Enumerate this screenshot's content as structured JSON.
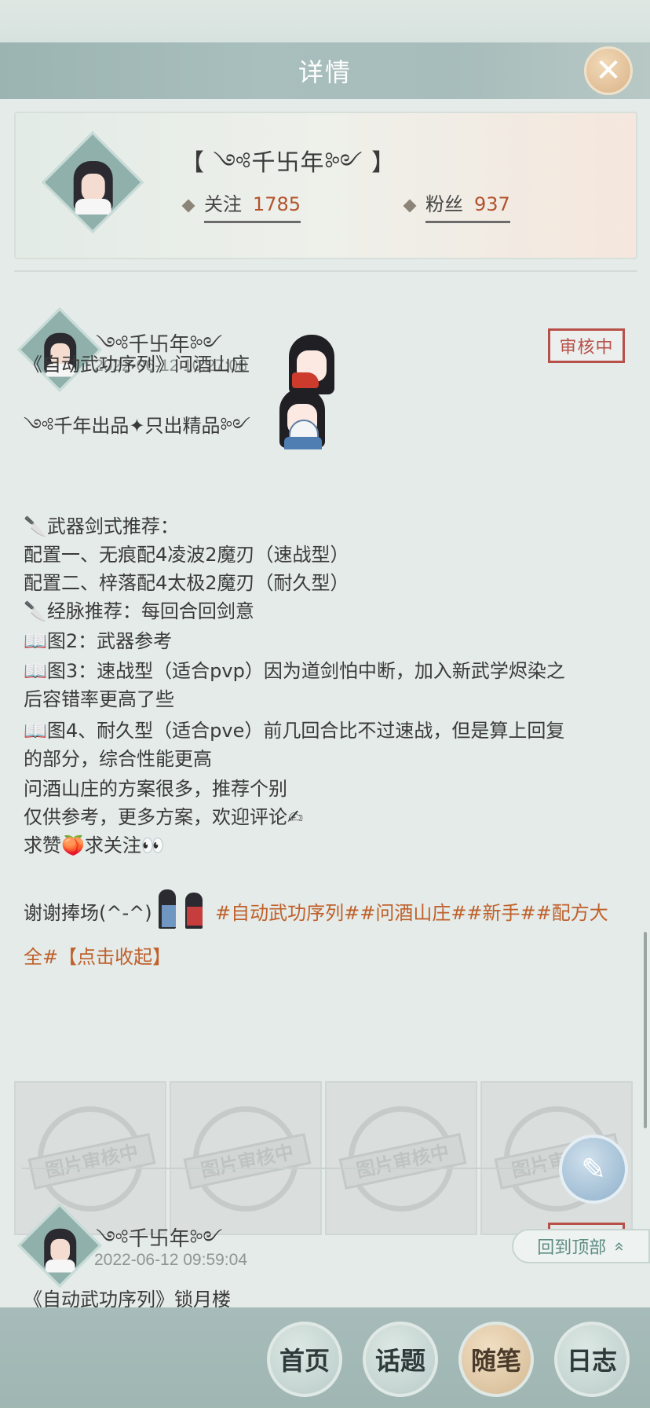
{
  "header": {
    "title": "详情",
    "close_label": "✕"
  },
  "profile": {
    "name": "【 ༺千卐年༻ 】",
    "follow_label": "关注",
    "follow_count": "1785",
    "fans_label": "粉丝",
    "fans_count": "937"
  },
  "posts": [
    {
      "author": "༺千卐年༻",
      "timestamp": "2022-06-12 10:27:08",
      "status": "审核中",
      "lines": [
        "《自动武功序列》问酒山庄",
        "༺千年出品✦只出精品༻",
        "🔪武器剑式推荐：",
        "配置一、无痕配4凌波2魔刃（速战型）",
        "配置二、梓落配4太极2魔刃（耐久型）",
        "🔪经脉推荐：每回合回剑意",
        "📖图2：武器参考",
        "📖图3：速战型（适合pvp）因为道剑怕中断，加入新武学烬染之",
        "后容错率更高了些",
        "📖图4、耐久型（适合pve）前几回合比不过速战，但是算上回复",
        "的部分，综合性能更高",
        "问酒山庄的方案很多，推荐个别",
        "仅供参考，更多方案，欢迎评论✍",
        "求赞🍑求关注👀"
      ],
      "thanks": "谢谢捧场(^-^)",
      "tags_line1": "#自动武功序列##问酒山庄##新手##配方大",
      "tags_line2": "全#",
      "collapse": "【点击收起】",
      "image_placeholder": "图片审核中"
    },
    {
      "author": "༺千卐年༻",
      "timestamp": "2022-06-12 09:59:04",
      "status": "审核中",
      "title": "《自动武功序列》锁月楼"
    }
  ],
  "back_to_top": "回到顶部",
  "back_to_top_icon": "»",
  "nav": [
    {
      "label": "首页",
      "active": false
    },
    {
      "label": "话题",
      "active": false
    },
    {
      "label": "随笔",
      "active": true
    },
    {
      "label": "日志",
      "active": false
    }
  ]
}
